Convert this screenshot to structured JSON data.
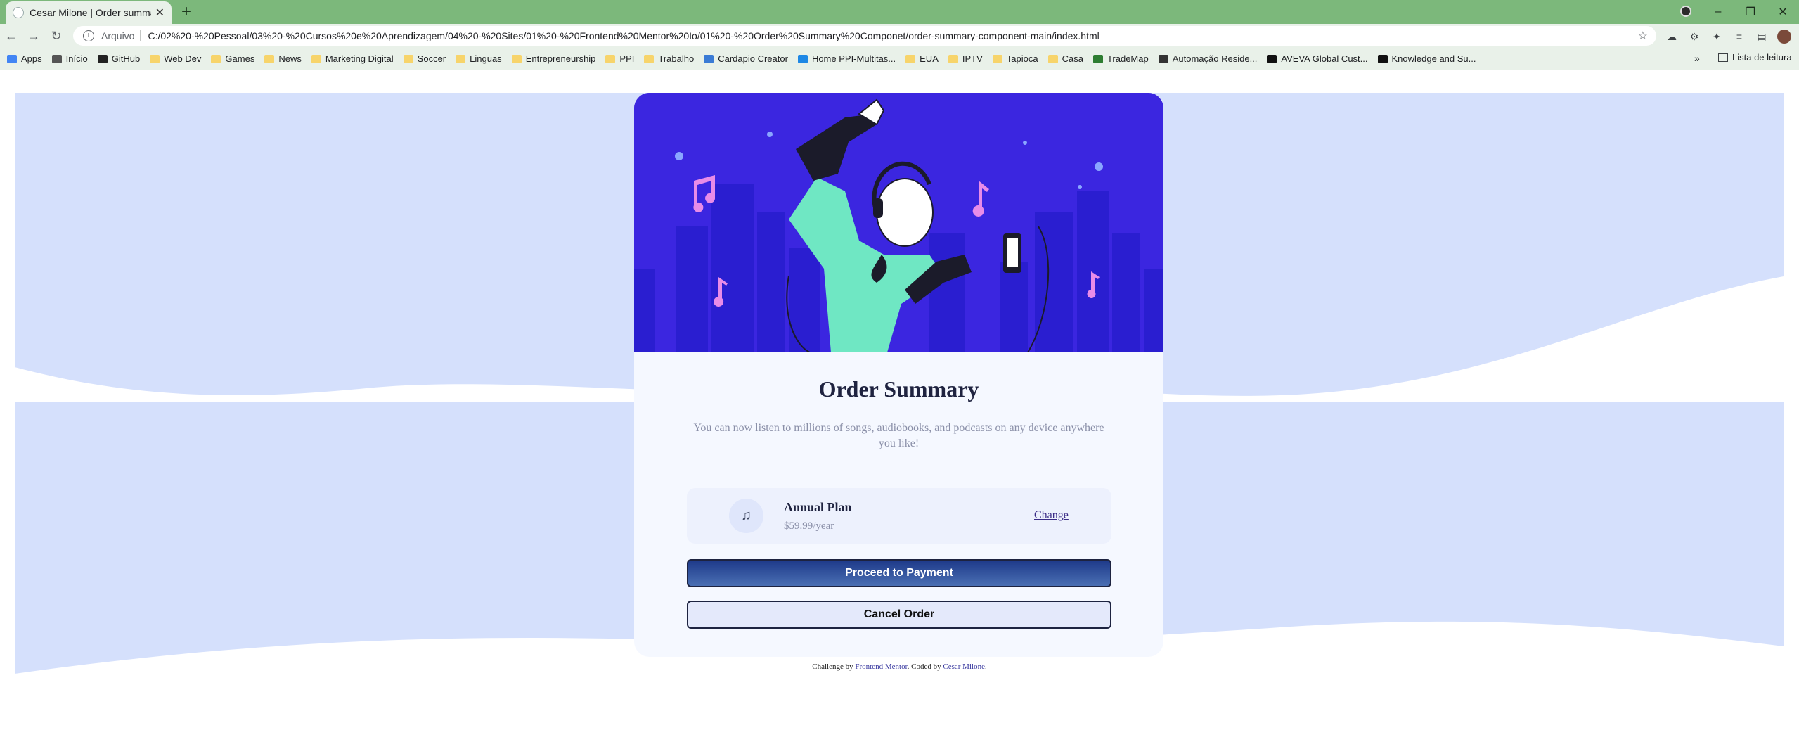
{
  "browser": {
    "tab_title": "Cesar Milone | Order summary co",
    "url_scheme": "Arquivo",
    "url": "C:/02%20-%20Pessoal/03%20-%20Cursos%20e%20Aprendizagem/04%20-%20Sites/01%20-%20Frontend%20Mentor%20Io/01%20-%20Order%20Summary%20Componet/order-summary-component-main/index.html",
    "bookmarks": [
      "Apps",
      "Início",
      "GitHub",
      "Web Dev",
      "Games",
      "News",
      "Marketing Digital",
      "Soccer",
      "Linguas",
      "Entrepreneurship",
      "PPI",
      "Trabalho",
      "Cardapio Creator",
      "Home PPI-Multitas...",
      "EUA",
      "IPTV",
      "Tapioca",
      "Casa",
      "TradeMap",
      "Automação Reside...",
      "AVEVA Global Cust...",
      "Knowledge and Su..."
    ],
    "reading_list": "Lista de leitura"
  },
  "card": {
    "title": "Order Summary",
    "description": "You can now listen to millions of songs, audiobooks, and podcasts on any device anywhere you like!",
    "plan_name": "Annual Plan",
    "plan_price": "$59.99/year",
    "change_label": "Change",
    "pay_label": "Proceed to Payment",
    "cancel_label": "Cancel Order"
  },
  "attribution": {
    "prefix": "Challenge by",
    "link1": "Frontend Mentor",
    "middle": ". Coded by",
    "link2": "Cesar Milone",
    "suffix": "."
  },
  "colors": {
    "hero_bg": "#3b26e0",
    "pattern": "#d5e0fc",
    "card_bg": "#f5f8ff",
    "chrome_green": "#7cb87b"
  }
}
